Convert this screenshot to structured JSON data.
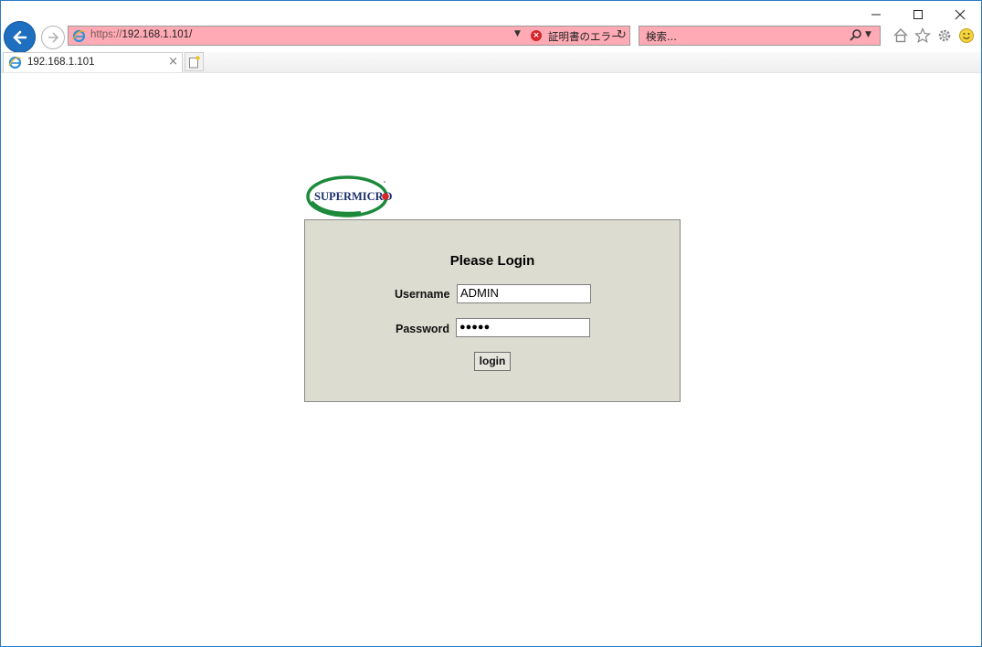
{
  "browser": {
    "url_protocol": "https://",
    "url_host": "192.168.1.101/",
    "cert_error": "証明書のエラー",
    "search_placeholder": "検索...",
    "tab_title": "192.168.1.101",
    "tab_close": "×"
  },
  "window_controls": {
    "minimize": "—",
    "maximize": "☐",
    "close": "✕"
  },
  "logo": {
    "brand": "SUPERMICRO"
  },
  "login": {
    "title": "Please Login",
    "username_label": "Username",
    "username_value": "ADMIN",
    "password_label": "Password",
    "password_value": "●●●●●",
    "button_label": "login"
  },
  "colors": {
    "address_bar_error": "#ffaab4",
    "login_panel": "#dddcd0",
    "back_button": "#1e6fbf",
    "logo_green": "#1d8a3b",
    "logo_navy": "#1a2f6b",
    "logo_red": "#d4262b"
  }
}
